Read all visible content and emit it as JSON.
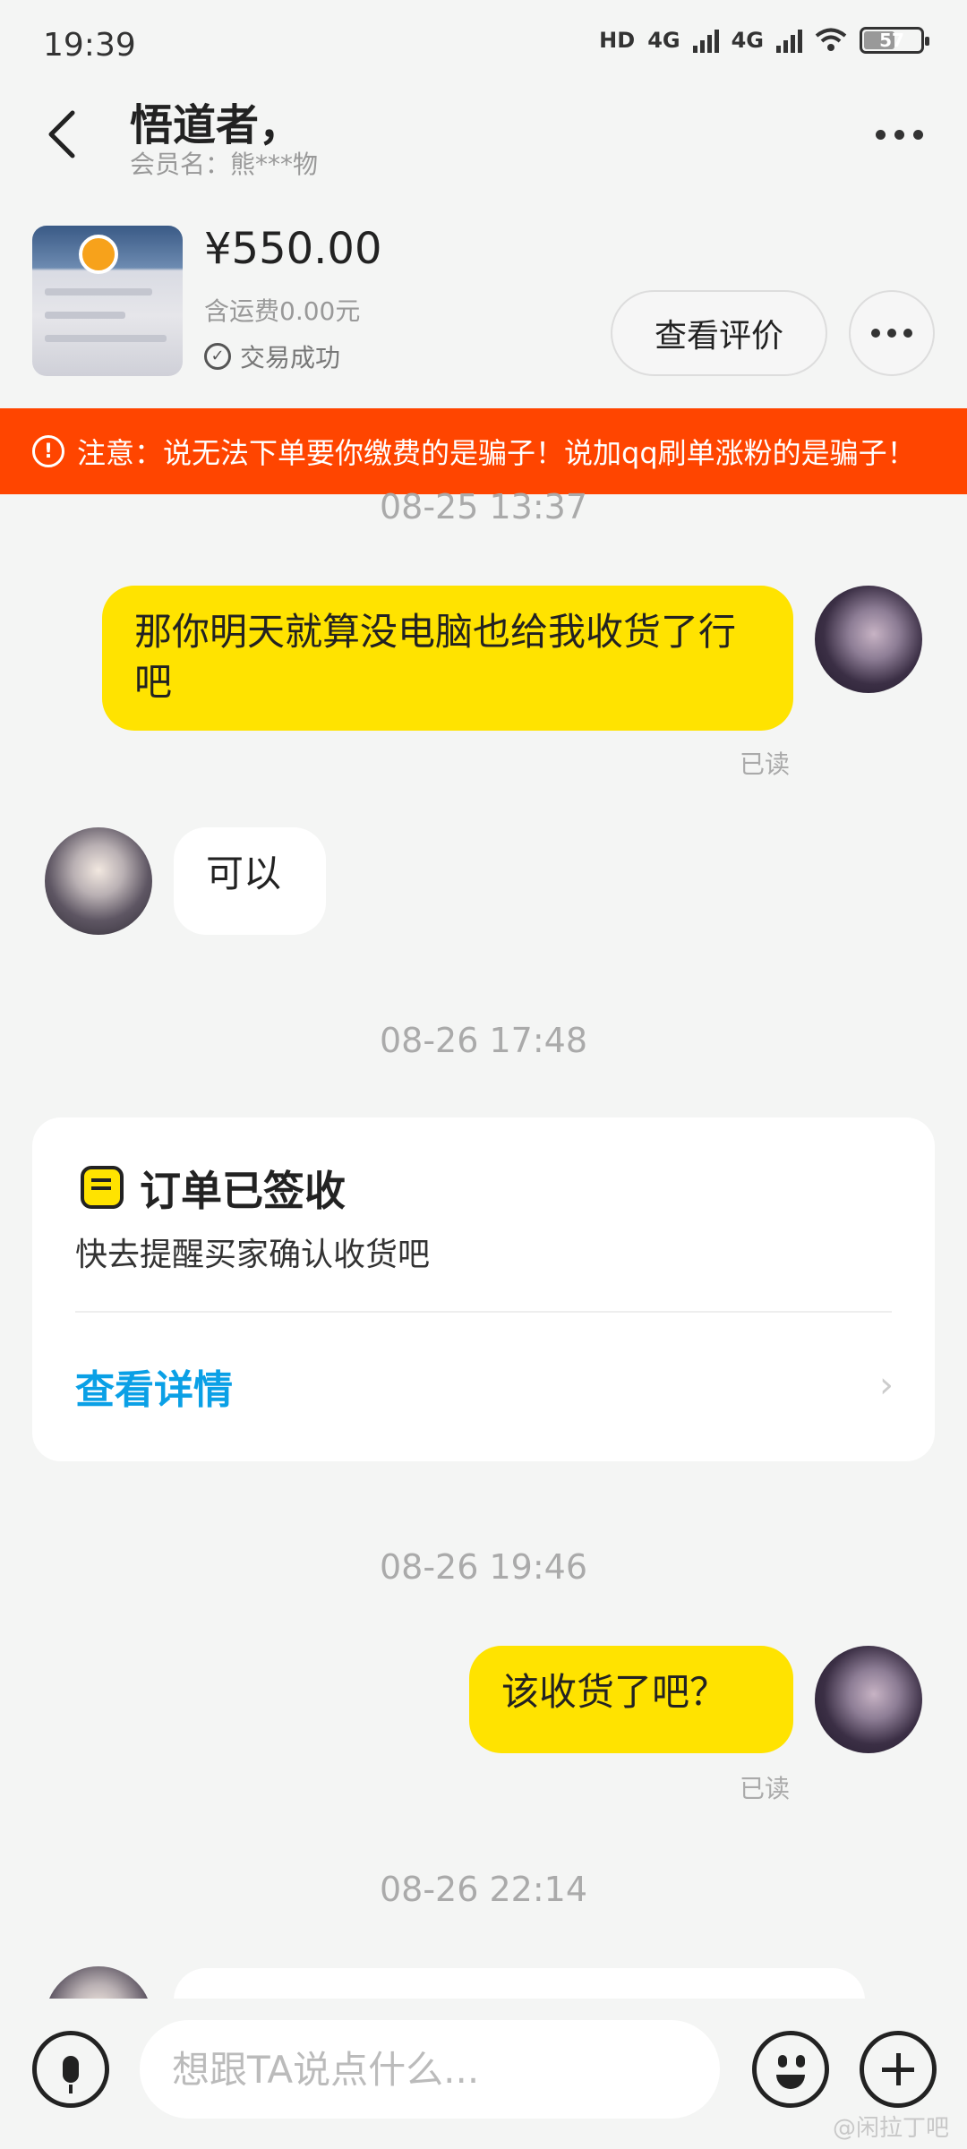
{
  "status_bar": {
    "time": "19:39",
    "hd_label": "HD",
    "network_1": "4G",
    "network_2": "4G",
    "battery": "57",
    "icons": [
      "hd-icon",
      "signal-icon",
      "signal-icon",
      "wifi-icon",
      "battery-icon"
    ]
  },
  "header": {
    "title": "悟道者，",
    "member_name": "会员名：熊***物",
    "back_icon": "back-arrow-icon",
    "more_icon": "more-dots-icon"
  },
  "product": {
    "price": "¥550.00",
    "shipping": "含运费0.00元",
    "status": "交易成功",
    "review_button": "查看评价"
  },
  "warning": {
    "text": "注意：说无法下单要你缴费的是骗子！说加qq刷单涨粉的是骗子！"
  },
  "chat": {
    "ts1": "08-25 13:37",
    "msg1": "那你明天就算没电脑也给我收货了行吧",
    "read1": "已读",
    "msg2": "可以",
    "ts2": "08-26 17:48",
    "order_card": {
      "title": "订单已签收",
      "desc": "快去提醒买家确认收货吧",
      "link": "查看详情"
    },
    "ts3": "08-26 19:46",
    "msg3": "该收货了吧？",
    "read3": "已读",
    "ts4": "08-26 22:14"
  },
  "input": {
    "placeholder": "想跟TA说点什么..."
  },
  "watermark": "@闲拉丁吧",
  "colors": {
    "accent_yellow": "#ffe300",
    "warning_red": "#ff4500",
    "link_blue": "#0aa0e6"
  }
}
